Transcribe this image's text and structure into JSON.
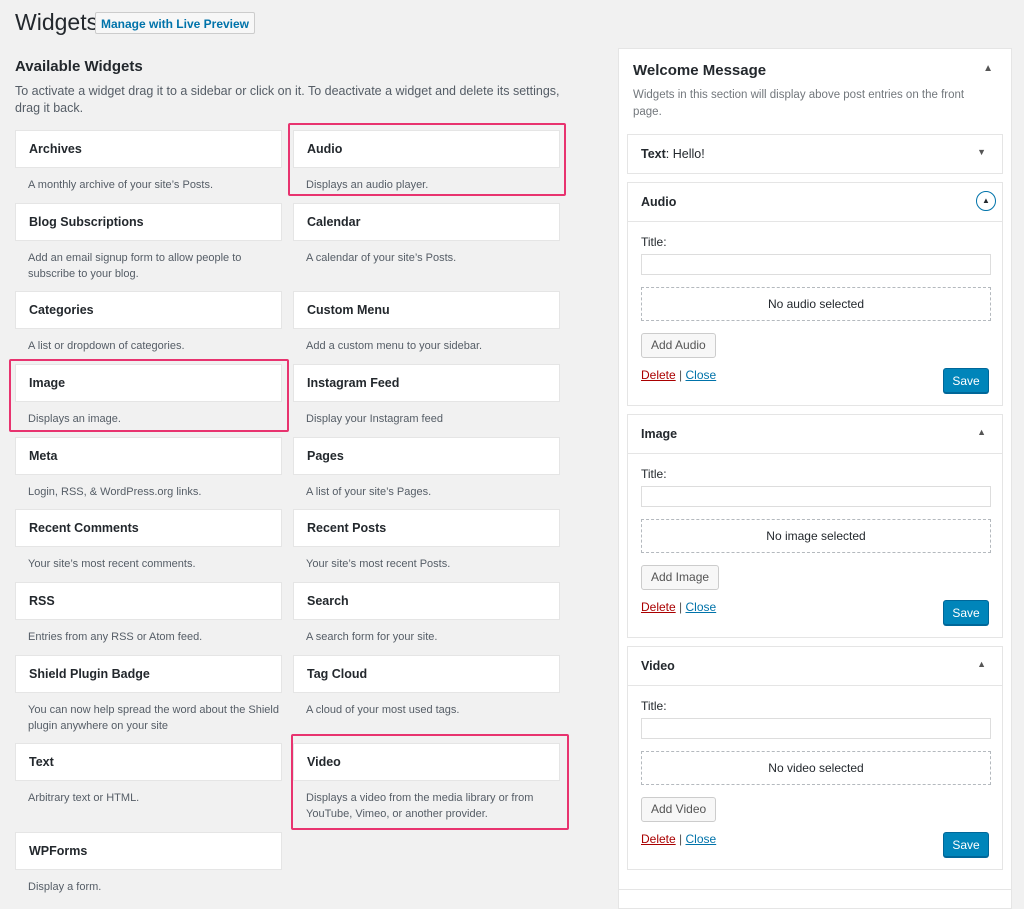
{
  "header": {
    "title": "Widgets",
    "live_preview_label": "Manage with Live Preview"
  },
  "available": {
    "title": "Available Widgets",
    "description": "To activate a widget drag it to a sidebar or click on it. To deactivate a widget and delete its settings, drag it back."
  },
  "widgets": [
    {
      "title": "Archives",
      "desc": "A monthly archive of your site’s Posts."
    },
    {
      "title": "Audio",
      "desc": "Displays an audio player."
    },
    {
      "title": "Blog Subscriptions",
      "desc": "Add an email signup form to allow people to subscribe to your blog."
    },
    {
      "title": "Calendar",
      "desc": "A calendar of your site’s Posts."
    },
    {
      "title": "Categories",
      "desc": "A list or dropdown of categories."
    },
    {
      "title": "Custom Menu",
      "desc": "Add a custom menu to your sidebar."
    },
    {
      "title": "Image",
      "desc": "Displays an image."
    },
    {
      "title": "Instagram Feed",
      "desc": "Display your Instagram feed"
    },
    {
      "title": "Meta",
      "desc": "Login, RSS, & WordPress.org links."
    },
    {
      "title": "Pages",
      "desc": "A list of your site’s Pages."
    },
    {
      "title": "Recent Comments",
      "desc": "Your site’s most recent comments."
    },
    {
      "title": "Recent Posts",
      "desc": "Your site’s most recent Posts."
    },
    {
      "title": "RSS",
      "desc": "Entries from any RSS or Atom feed."
    },
    {
      "title": "Search",
      "desc": "A search form for your site."
    },
    {
      "title": "Shield Plugin Badge",
      "desc": "You can now help spread the word about the Shield plugin anywhere on your site"
    },
    {
      "title": "Tag Cloud",
      "desc": "A cloud of your most used tags."
    },
    {
      "title": "Text",
      "desc": "Arbitrary text or HTML."
    },
    {
      "title": "Video",
      "desc": "Displays a video from the media library or from YouTube, Vimeo, or another provider."
    },
    {
      "title": "WPForms",
      "desc": "Display a form."
    }
  ],
  "sidebar": {
    "title": "Welcome Message",
    "description": "Widgets in this section will display above post entries on the front page.",
    "text_widget": {
      "title": "Text",
      "subtitle": ": Hello!"
    },
    "audio": {
      "title": "Audio",
      "field_label": "Title:",
      "placeholder": "No audio selected",
      "add_label": "Add Audio"
    },
    "image": {
      "title": "Image",
      "field_label": "Title:",
      "placeholder": "No image selected",
      "add_label": "Add Image"
    },
    "video": {
      "title": "Video",
      "field_label": "Title:",
      "placeholder": "No video selected",
      "add_label": "Add Video"
    },
    "delete_label": "Delete",
    "separator": "|",
    "close_label": "Close",
    "save_label": "Save"
  },
  "icons": {
    "collapse": "triangle-up-icon",
    "expand": "triangle-down-icon"
  },
  "colors": {
    "highlight": "#e8336f",
    "link": "#0073aa",
    "delete": "#a00000",
    "primary_button": "#0085ba"
  }
}
